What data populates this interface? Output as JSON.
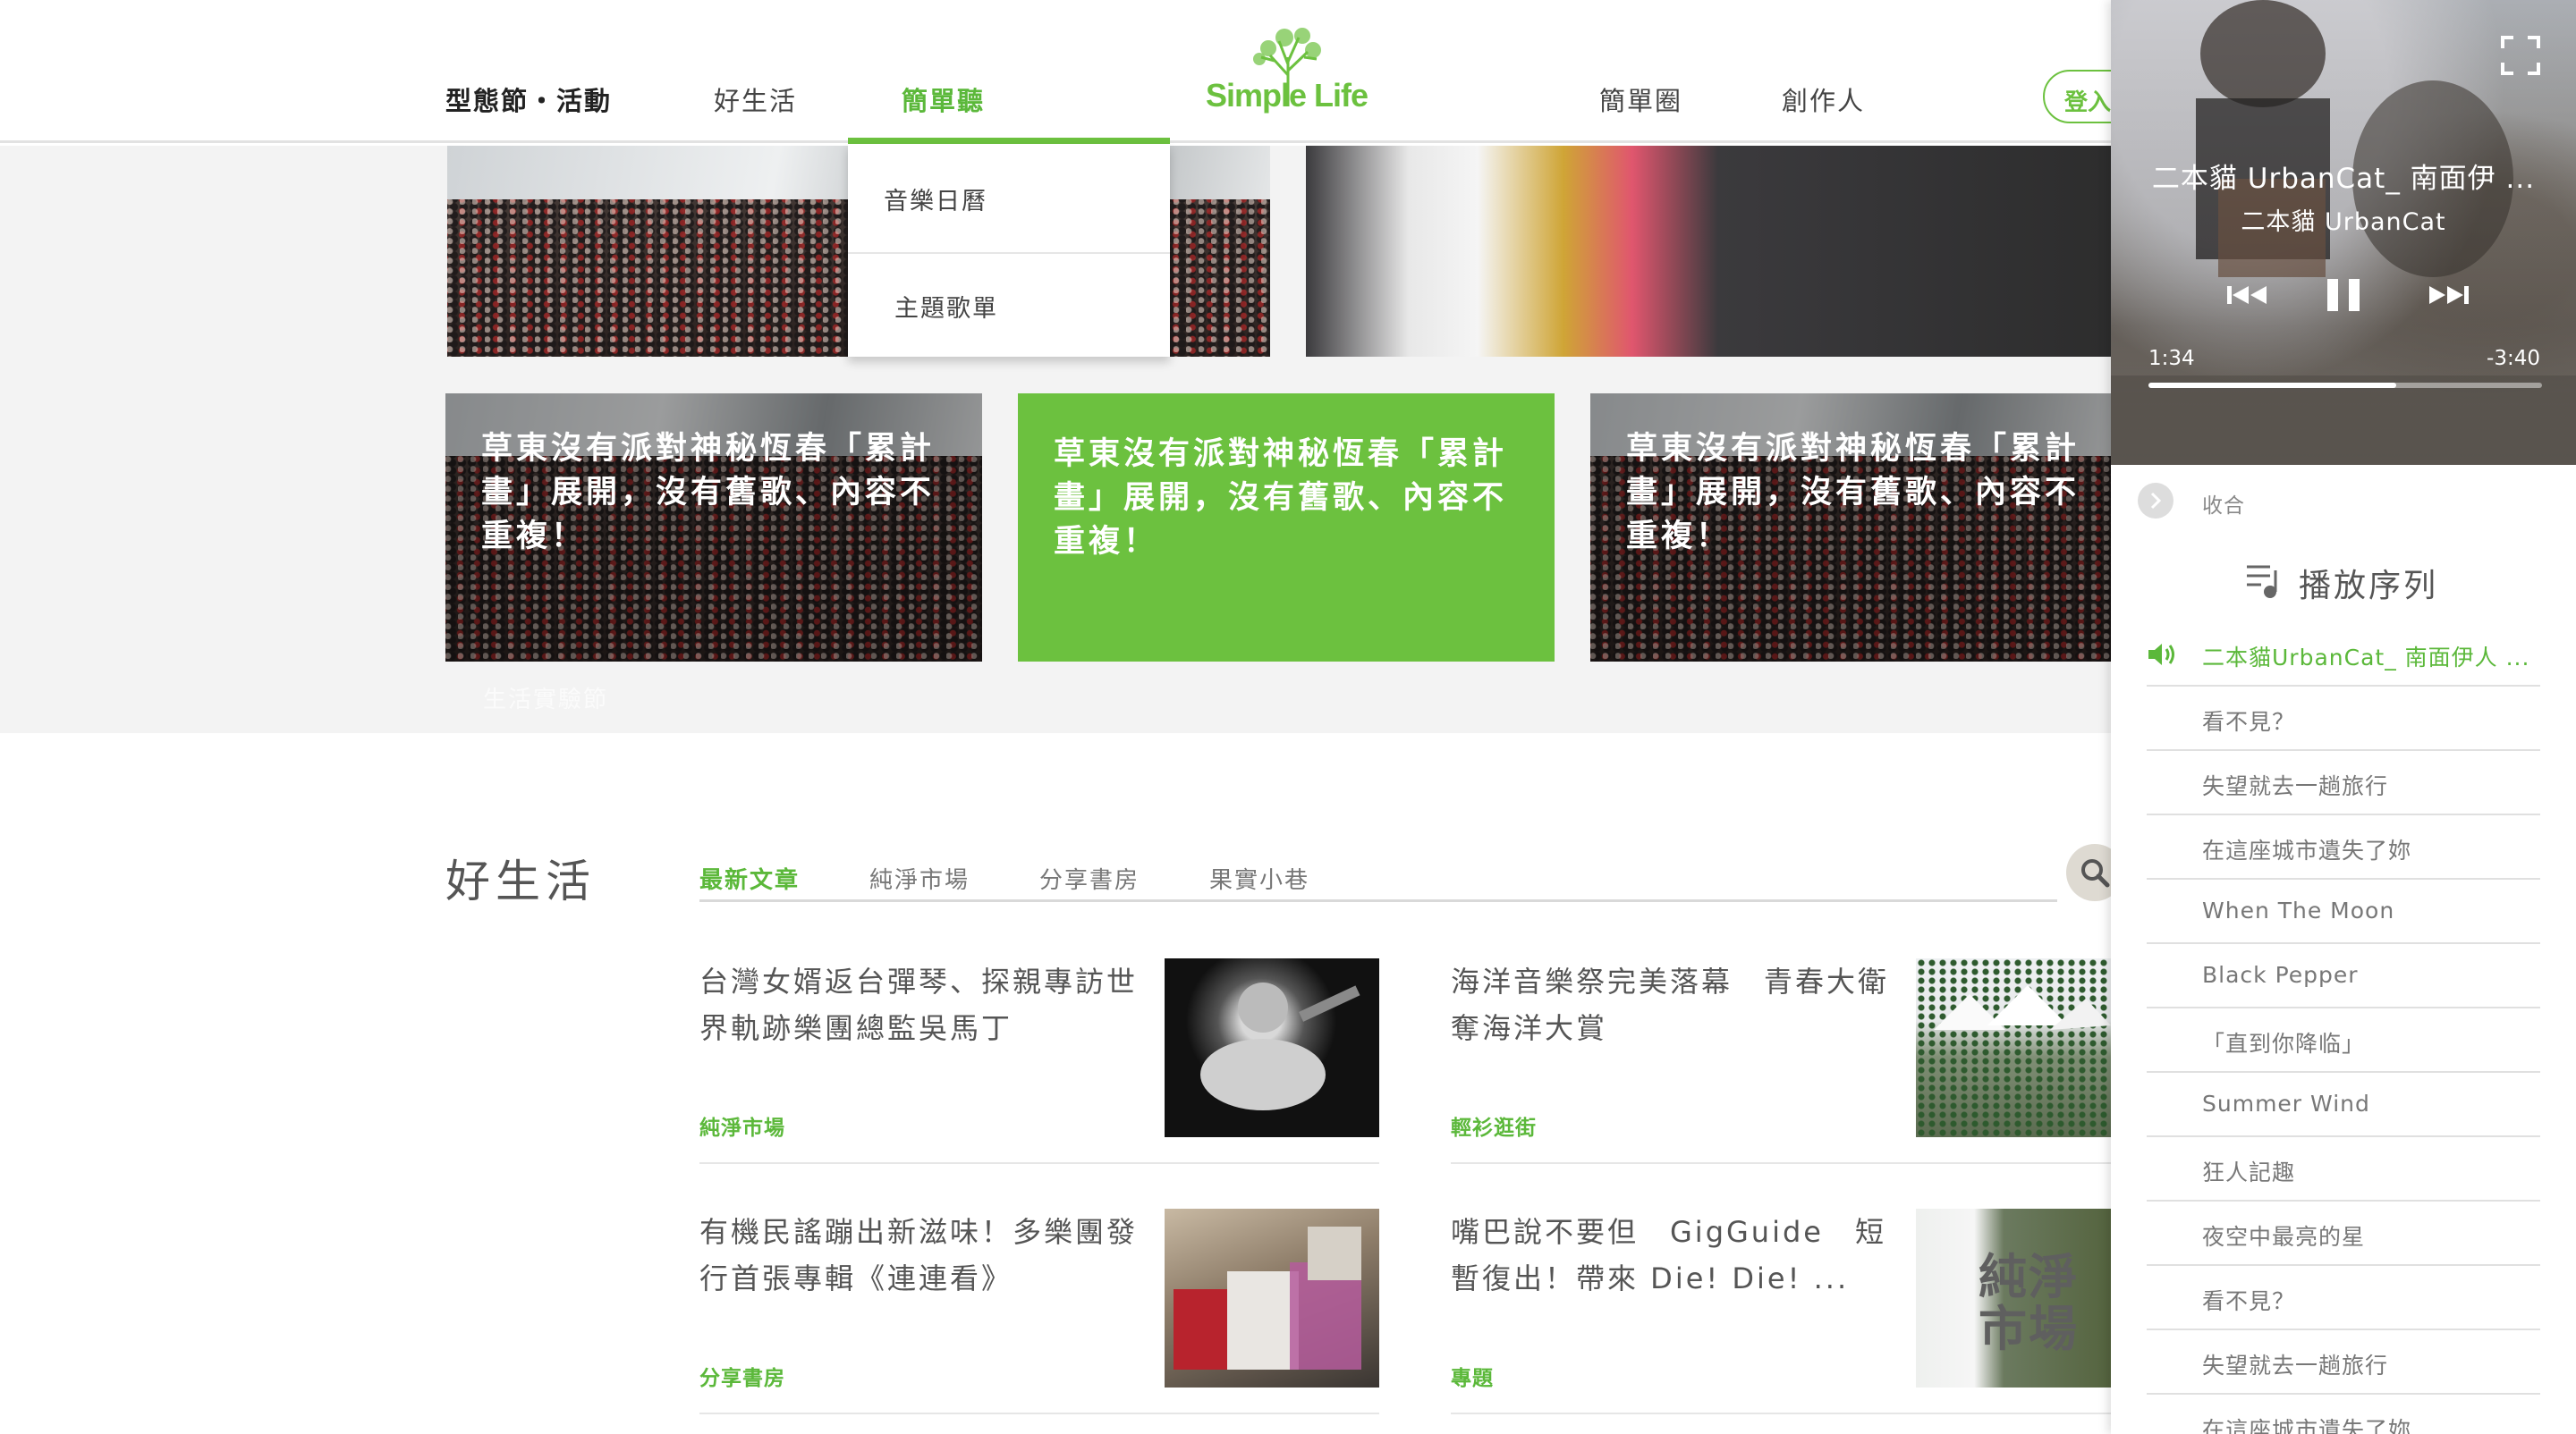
{
  "nav": {
    "items": [
      "型態節・活動",
      "好生活",
      "簡單聽",
      "簡單圈",
      "創作人"
    ],
    "login": "登入",
    "logo": "Simple Life"
  },
  "dropdown": {
    "items": [
      "音樂日曆",
      "主題歌單"
    ]
  },
  "featured": {
    "cards": [
      "草東沒有派對神秘恆春「累計畫」展開，沒有舊歌、內容不重複！",
      "草東沒有派對神秘恆春「累計畫」展開，沒有舊歌、內容不重複！",
      "草東沒有派對神秘恆春「累計畫」展開，沒有舊歌、內容不重複！"
    ],
    "ghost_label": "生活實驗節",
    "accent_color": "#6cc13f"
  },
  "section": {
    "title": "好生活",
    "tabs": [
      "最新文章",
      "純淨市場",
      "分享書房",
      "果實小巷"
    ],
    "articles": [
      {
        "title": "台灣女婿返台彈琴、探親專訪世界軌跡樂團總監吳馬丁",
        "tag": "純淨市場"
      },
      {
        "title": "海洋音樂祭完美落幕　青春大衛奪海洋大賞",
        "tag": "輕衫逛街"
      },
      {
        "title": "有機民謠蹦出新滋味！多樂團發行首張專輯《連連看》",
        "tag": "分享書房"
      },
      {
        "title": "嘴巴說不要但　GigGuide　短暫復出！帶來 Die! Die! ...",
        "tag": "專題"
      }
    ],
    "thumb_text": "純淨市場"
  },
  "player": {
    "title": "二本貓 UrbanCat_ 南面伊 ...",
    "artist": "二本貓 UrbanCat",
    "elapsed": "1:34",
    "remaining": "-3:40",
    "progress": 0.63,
    "collapse": "收合",
    "queue_title": "播放序列",
    "queue": [
      "二本貓UrbanCat_ 南面伊人 ...",
      "看不見？",
      "失望就去一趟旅行",
      "在這座城市遺失了妳",
      "When The Moon",
      "Black Pepper",
      "「直到你降临」",
      "Summer Wind",
      "狂人記趣",
      "夜空中最亮的星",
      "看不見？",
      "失望就去一趟旅行",
      "在這座城市遺失了妳"
    ]
  }
}
